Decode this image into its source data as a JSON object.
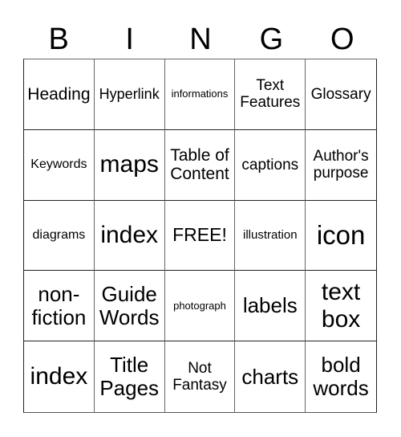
{
  "header": {
    "letters": [
      "B",
      "I",
      "N",
      "G",
      "O"
    ]
  },
  "cells": [
    {
      "text": "Heading"
    },
    {
      "text": "Hyperlink"
    },
    {
      "text": "informations"
    },
    {
      "text": "Text Features"
    },
    {
      "text": "Glossary"
    },
    {
      "text": "Keywords"
    },
    {
      "text": "maps"
    },
    {
      "text": "Table of Content"
    },
    {
      "text": "captions"
    },
    {
      "text": "Author's purpose"
    },
    {
      "text": "diagrams"
    },
    {
      "text": "index"
    },
    {
      "text": "FREE!"
    },
    {
      "text": "illustration"
    },
    {
      "text": "icon"
    },
    {
      "text": "non-fiction"
    },
    {
      "text": "Guide Words"
    },
    {
      "text": "photograph"
    },
    {
      "text": "labels"
    },
    {
      "text": "text box"
    },
    {
      "text": "index"
    },
    {
      "text": "Title Pages"
    },
    {
      "text": "Not Fantasy"
    },
    {
      "text": "charts"
    },
    {
      "text": "bold words"
    }
  ]
}
